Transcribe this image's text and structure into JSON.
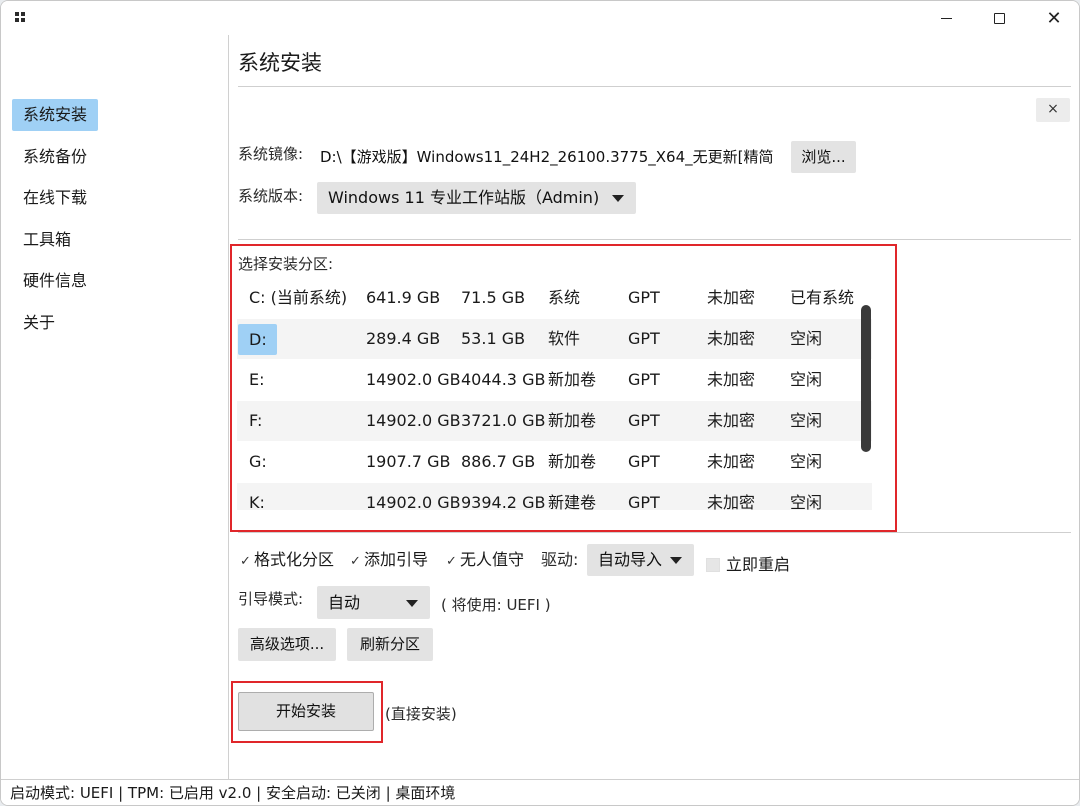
{
  "window": {
    "minimize_glyph": "",
    "close_glyph": "✕"
  },
  "sidebar": {
    "items": [
      {
        "label": "系统安装",
        "active": true
      },
      {
        "label": "系统备份"
      },
      {
        "label": "在线下载"
      },
      {
        "label": "工具箱"
      },
      {
        "label": "硬件信息"
      },
      {
        "label": "关于"
      }
    ]
  },
  "main": {
    "title": "系统安装",
    "close_small": "×",
    "image_label": "系统镜像:",
    "image_path": "D:\\【游戏版】Windows11_24H2_26100.3775_X64_无更新[精简",
    "browse_button": "浏览...",
    "version_label": "系统版本:",
    "version_value": "Windows 11 专业工作站版（Admin)",
    "partition_label": "选择安装分区:",
    "partitions": [
      {
        "drive": "C: (当前系统)",
        "size": "641.9 GB",
        "free": "71.5 GB",
        "name": "系统",
        "style": "GPT",
        "encryption": "未加密",
        "status": "已有系统"
      },
      {
        "drive": "D:",
        "size": "289.4 GB",
        "free": "53.1 GB",
        "name": "软件",
        "style": "GPT",
        "encryption": "未加密",
        "status": "空闲",
        "selected": true
      },
      {
        "drive": "E:",
        "size": "14902.0 GB",
        "free": "4044.3 GB",
        "name": "新加卷",
        "style": "GPT",
        "encryption": "未加密",
        "status": "空闲"
      },
      {
        "drive": "F:",
        "size": "14902.0 GB",
        "free": "3721.0 GB",
        "name": "新加卷",
        "style": "GPT",
        "encryption": "未加密",
        "status": "空闲"
      },
      {
        "drive": "G:",
        "size": "1907.7 GB",
        "free": "886.7 GB",
        "name": "新加卷",
        "style": "GPT",
        "encryption": "未加密",
        "status": "空闲"
      },
      {
        "drive": "K:",
        "size": "14902.0 GB",
        "free": "9394.2 GB",
        "name": "新建卷",
        "style": "GPT",
        "encryption": "未加密",
        "status": "空闲"
      }
    ],
    "options": {
      "format": {
        "label": "格式化分区",
        "checked": true
      },
      "add_boot": {
        "label": "添加引导",
        "checked": true
      },
      "unattended": {
        "label": "无人值守",
        "checked": true
      },
      "driver_label": "驱动:",
      "driver_value": "自动导入",
      "reboot": {
        "label": "立即重启",
        "checked": false
      },
      "check_glyph": "✓"
    },
    "boot_mode_label": "引导模式:",
    "boot_mode_value": "自动",
    "boot_mode_hint": "( 将使用: UEFI )",
    "advanced_button": "高级选项...",
    "refresh_button": "刷新分区",
    "install_button": "开始安装",
    "install_hint": "(直接安装)"
  },
  "status_bar": "启动模式: UEFI | TPM: 已启用 v2.0 | 安全启动: 已关闭 | 桌面环境",
  "colors": {
    "accent_selected": "#9fd0f5",
    "highlight_border": "#e0262a"
  }
}
